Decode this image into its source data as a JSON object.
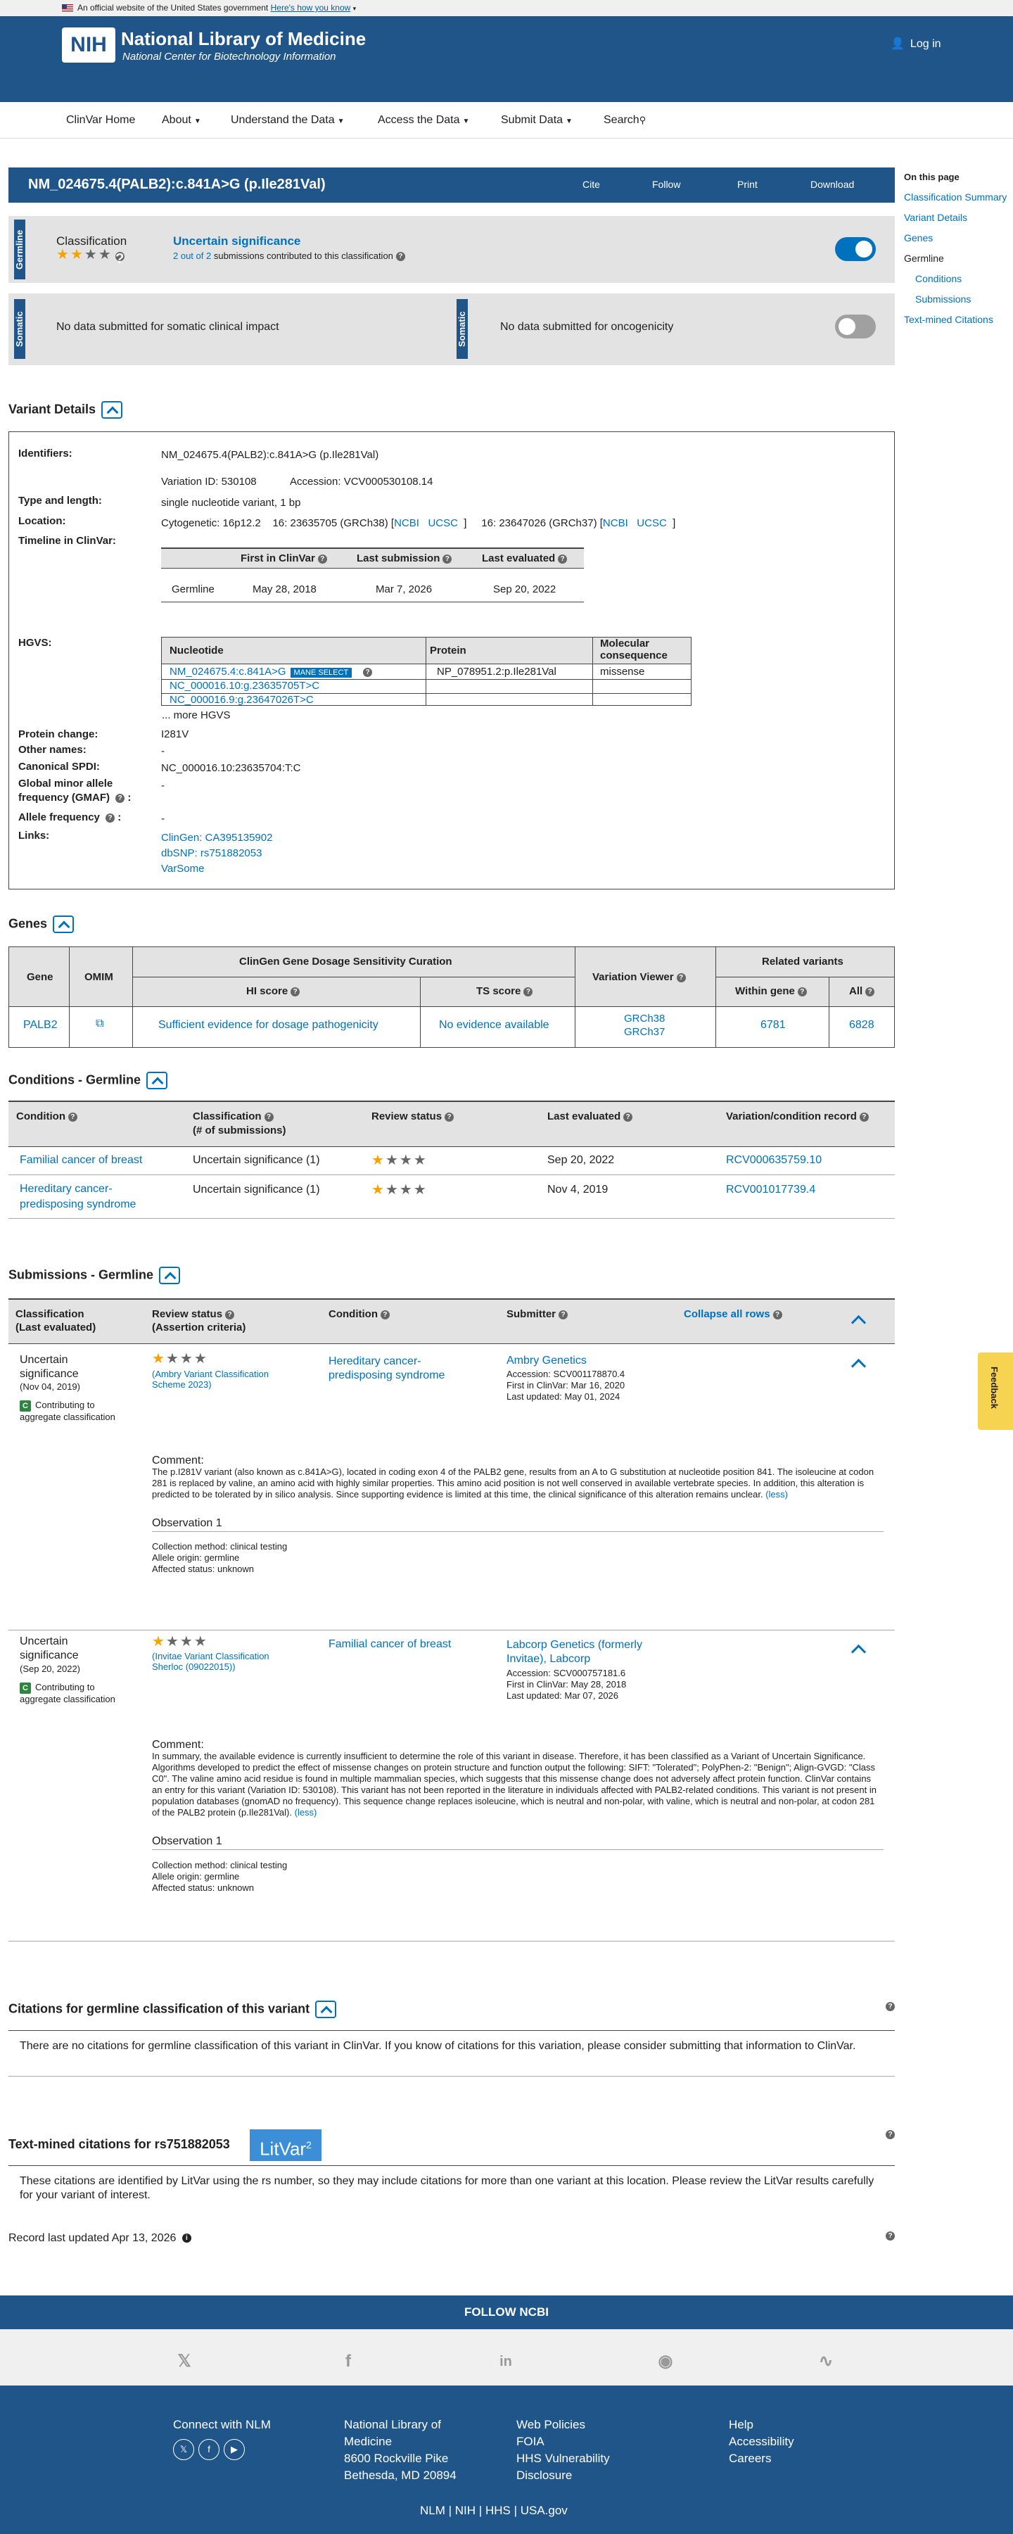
{
  "gov_banner": {
    "text": "An official website of the United States government",
    "link": "Here's how you know"
  },
  "header": {
    "logo": "NIH",
    "title": "National Library of Medicine",
    "subtitle": "National Center for Biotechnology Information",
    "login": "Log in"
  },
  "nav": {
    "items": [
      "ClinVar Home",
      "About",
      "Understand the Data",
      "Access the Data",
      "Submit Data",
      "Search"
    ]
  },
  "variant_bar": {
    "title": "NM_024675.4(PALB2):c.841A>G (p.Ile281Val)",
    "actions": [
      "Cite",
      "Follow",
      "Print",
      "Download"
    ]
  },
  "on_this_page": {
    "heading": "On this page",
    "items": [
      "Classification Summary",
      "Variant Details",
      "Genes",
      "Germline",
      "Conditions",
      "Submissions",
      "Text-mined Citations"
    ]
  },
  "germline": {
    "label": "Germline",
    "classification_label": "Classification",
    "classification": "Uncertain significance",
    "submissions_link": "2 out of 2",
    "submissions_text": "submissions contributed to this classification"
  },
  "somatic": {
    "label": "Somatic",
    "left": "No data submitted for somatic clinical impact",
    "right": "No data submitted for oncogenicity"
  },
  "variant_details": {
    "heading": "Variant Details",
    "identifiers_label": "Identifiers:",
    "identifiers": "NM_024675.4(PALB2):c.841A>G (p.Ile281Val)",
    "variation_id": "Variation ID: 530108",
    "accession": "Accession: VCV000530108.14",
    "type_label": "Type and length:",
    "type": "single nucleotide variant, 1 bp",
    "location_label": "Location:",
    "cytogenetic": "Cytogenetic: 16p12.2",
    "loc38": "16: 23635705 (GRCh38) [",
    "loc37": "16: 23647026 (GRCh37) [",
    "ncbi": "NCBI",
    "ucsc": "UCSC",
    "timeline_label": "Timeline in ClinVar:",
    "timeline_headers": [
      "First in ClinVar",
      "Last submission",
      "Last evaluated"
    ],
    "timeline_row": [
      "Germline",
      "May 28, 2018",
      "Mar 7, 2026",
      "Sep 20, 2022"
    ],
    "hgvs_label": "HGVS:",
    "hgvs_headers": [
      "Nucleotide",
      "Protein",
      "Molecular consequence"
    ],
    "mane": "MANE SELECT",
    "hgvs_rows": [
      [
        "NM_024675.4:c.841A>G",
        "NP_078951.2:p.Ile281Val",
        "missense"
      ],
      [
        "NC_000016.10:g.23635705T>C",
        "",
        ""
      ],
      [
        "NC_000016.9:g.23647026T>C",
        "",
        ""
      ]
    ],
    "more_hgvs": "... more HGVS",
    "protein_change_label": "Protein change:",
    "protein_change": "I281V",
    "other_names_label": "Other names:",
    "other_names": "-",
    "spdi_label": "Canonical SPDI:",
    "spdi": "NC_000016.10:23635704:T:C",
    "gmaf_label": "Global minor allele frequency (GMAF)",
    "gmaf": "-",
    "af_label": "Allele frequency",
    "af": "-",
    "links_label": "Links:",
    "links": [
      "ClinGen: CA395135902",
      "dbSNP: rs751882053",
      "VarSome"
    ]
  },
  "genes": {
    "heading": "Genes",
    "group_headers": [
      "ClinGen Gene Dosage Sensitivity Curation",
      "Related variants"
    ],
    "headers": [
      "Gene",
      "OMIM",
      "HI score",
      "TS score",
      "Variation Viewer",
      "Within gene",
      "All"
    ],
    "row": {
      "gene": "PALB2",
      "hi": "Sufficient evidence for dosage pathogenicity",
      "ts": "No evidence available",
      "vv1": "GRCh38",
      "vv2": "GRCh37",
      "within": "6781",
      "all": "6828"
    }
  },
  "conditions": {
    "heading": "Conditions - Germline",
    "headers": [
      "Condition",
      "Classification",
      "(# of submissions)",
      "Review status",
      "Last evaluated",
      "Variation/condition record"
    ],
    "rows": [
      {
        "condition": "Familial cancer of breast",
        "classification": "Uncertain significance (1)",
        "evaluated": "Sep 20, 2022",
        "record": "RCV000635759.10"
      },
      {
        "condition": "Hereditary cancer-predisposing syndrome",
        "classification": "Uncertain significance (1)",
        "evaluated": "Nov 4, 2019",
        "record": "RCV001017739.4"
      }
    ]
  },
  "submissions": {
    "heading": "Submissions - Germline",
    "headers": [
      "Classification",
      "(Last evaluated)",
      "Review status",
      "(Assertion criteria)",
      "Condition",
      "Submitter",
      "Collapse all rows"
    ],
    "items": [
      {
        "classification": "Uncertain significance",
        "date": "(Nov 04, 2019)",
        "contrib": "Contributing to aggregate classification",
        "criteria": "(Ambry Variant Classification Scheme 2023)",
        "condition": "Hereditary cancer-predisposing syndrome",
        "submitter": "Ambry Genetics",
        "accession": "Accession: SCV001178870.4",
        "first": "First in ClinVar: Mar 16, 2020",
        "updated": "Last updated: May 01, 2024",
        "comment_label": "Comment:",
        "comment": "The p.I281V variant (also known as c.841A>G), located in coding exon 4 of the PALB2 gene, results from an A to G substitution at nucleotide position 841. The isoleucine at codon 281 is replaced by valine, an amino acid with highly similar properties. This amino acid position is not well conserved in available vertebrate species. In addition, this alteration is predicted to be tolerated by in silico analysis. Since supporting evidence is limited at this time, the clinical significance of this alteration remains unclear.",
        "less": "(less)",
        "obs": "Observation 1",
        "method": "Collection method: clinical testing",
        "origin": "Allele origin: germline",
        "status": "Affected status: unknown"
      },
      {
        "classification": "Uncertain significance",
        "date": "(Sep 20, 2022)",
        "contrib": "Contributing to aggregate classification",
        "criteria": "(Invitae Variant Classification Sherloc (09022015))",
        "condition": "Familial cancer of breast",
        "submitter": "Labcorp Genetics (formerly Invitae), Labcorp",
        "accession": "Accession: SCV000757181.6",
        "first": "First in ClinVar: May 28, 2018",
        "updated": "Last updated: Mar 07, 2026",
        "comment_label": "Comment:",
        "comment": "In summary, the available evidence is currently insufficient to determine the role of this variant in disease. Therefore, it has been classified as a Variant of Uncertain Significance. Algorithms developed to predict the effect of missense changes on protein structure and function output the following: SIFT: \"Tolerated\"; PolyPhen-2: \"Benign\"; Align-GVGD: \"Class C0\". The valine amino acid residue is found in multiple mammalian species, which suggests that this missense change does not adversely affect protein function. ClinVar contains an entry for this variant (Variation ID: 530108). This variant has not been reported in the literature in individuals affected with PALB2-related conditions. This variant is not present in population databases (gnomAD no frequency). This sequence change replaces isoleucine, which is neutral and non-polar, with valine, which is neutral and non-polar, at codon 281 of the PALB2 protein (p.Ile281Val).",
        "less": "(less)",
        "obs": "Observation 1",
        "method": "Collection method: clinical testing",
        "origin": "Allele origin: germline",
        "status": "Affected status: unknown"
      }
    ]
  },
  "citations": {
    "heading": "Citations for germline classification of this variant",
    "text": "There are no citations for germline classification of this variant in ClinVar. If you know of citations for this variation, please consider submitting that information to ClinVar."
  },
  "textmined": {
    "heading": "Text-mined citations for rs751882053",
    "litvar": "LitVar",
    "litvar_sup": "2",
    "text": "These citations are identified by LitVar using the rs number, so they may include citations for more than one variant at this location. Please review the LitVar results carefully for your variant of interest."
  },
  "record_updated": "Record last updated Apr 13, 2026",
  "feedback": "Feedback",
  "footer": {
    "follow": "FOLLOW NCBI",
    "connect": "Connect with NLM",
    "address": [
      "National Library of",
      "Medicine",
      "8600 Rockville Pike",
      "Bethesda, MD 20894"
    ],
    "policies": [
      "Web Policies",
      "FOIA",
      "HHS Vulnerability",
      "Disclosure"
    ],
    "help": [
      "Help",
      "Accessibility",
      "Careers"
    ],
    "bottom": [
      "NLM",
      "NIH",
      "HHS",
      "USA.gov"
    ]
  }
}
